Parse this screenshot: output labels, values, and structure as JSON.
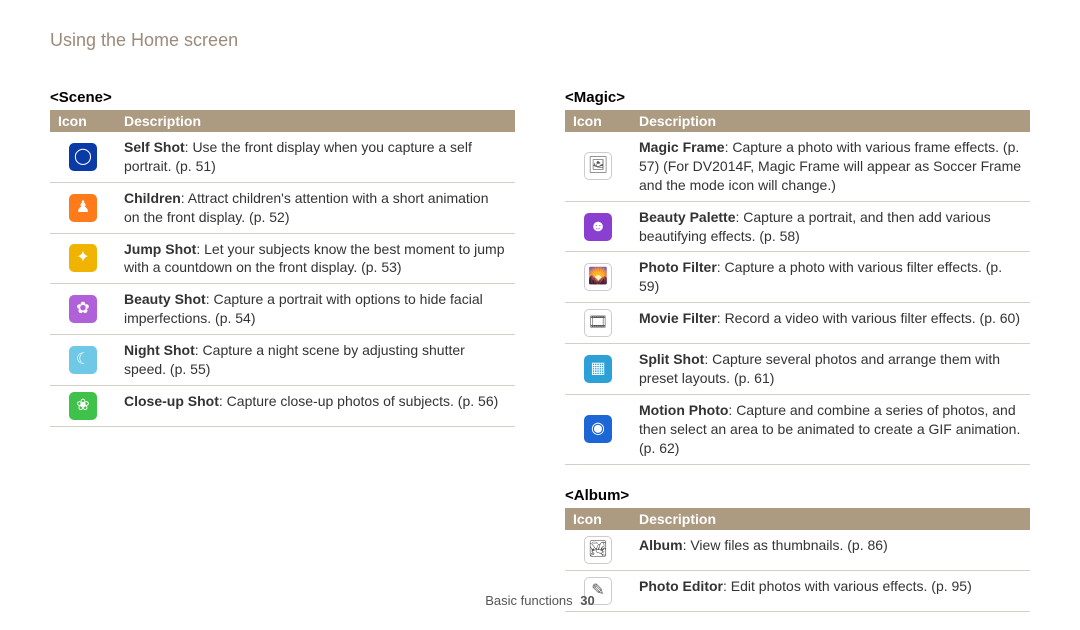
{
  "page_heading": "Using the Home screen",
  "table_headers": {
    "icon": "Icon",
    "description": "Description"
  },
  "sections": {
    "scene": {
      "title": "<Scene>",
      "rows": [
        {
          "icon": {
            "name": "self-shot-icon",
            "glyph": "◯",
            "bg": "#0a3aa6"
          },
          "bold": "Self Shot",
          "rest": ": Use the front display when you capture a self portrait. (p. 51)"
        },
        {
          "icon": {
            "name": "children-icon",
            "glyph": "♟",
            "bg": "#ff7a1a"
          },
          "bold": "Children",
          "rest": ": Attract children's attention with a short animation on the front display. (p. 52)"
        },
        {
          "icon": {
            "name": "jump-shot-icon",
            "glyph": "✦",
            "bg": "#f0b400"
          },
          "bold": "Jump Shot",
          "rest": ": Let your subjects know the best moment to jump with a countdown on the front display. (p. 53)"
        },
        {
          "icon": {
            "name": "beauty-shot-icon",
            "glyph": "✿",
            "bg": "#b060d8"
          },
          "bold": "Beauty Shot",
          "rest": ": Capture a portrait with options to hide facial imperfections. (p. 54)"
        },
        {
          "icon": {
            "name": "night-shot-icon",
            "glyph": "☾",
            "bg": "#6fc8e6"
          },
          "bold": "Night Shot",
          "rest": ": Capture a night scene by adjusting shutter speed. (p. 55)"
        },
        {
          "icon": {
            "name": "close-up-shot-icon",
            "glyph": "❀",
            "bg": "#3fc24a"
          },
          "bold": "Close-up Shot",
          "rest": ": Capture close-up photos of subjects. (p. 56)"
        }
      ]
    },
    "magic": {
      "title": "<Magic>",
      "rows": [
        {
          "icon": {
            "name": "magic-frame-icon",
            "glyph": "🖼",
            "bg": "#ffffff"
          },
          "bold": "Magic Frame",
          "rest": ": Capture a photo with various frame effects. (p. 57) (For DV2014F, Magic Frame will appear as Soccer Frame and the mode icon will change.)"
        },
        {
          "icon": {
            "name": "beauty-palette-icon",
            "glyph": "☻",
            "bg": "#8a3fd0"
          },
          "bold": "Beauty Palette",
          "rest": ": Capture a portrait, and then add various beautifying effects. (p. 58)"
        },
        {
          "icon": {
            "name": "photo-filter-icon",
            "glyph": "🌄",
            "bg": "#ffffff"
          },
          "bold": "Photo Filter",
          "rest": ": Capture a photo with various filter effects. (p. 59)"
        },
        {
          "icon": {
            "name": "movie-filter-icon",
            "glyph": "🎞",
            "bg": "#ffffff"
          },
          "bold": "Movie Filter",
          "rest": ": Record a video with various filter effects. (p. 60)"
        },
        {
          "icon": {
            "name": "split-shot-icon",
            "glyph": "▦",
            "bg": "#2ea0d8"
          },
          "bold": "Split Shot",
          "rest": ": Capture several photos and arrange them with preset layouts. (p. 61)"
        },
        {
          "icon": {
            "name": "motion-photo-icon",
            "glyph": "◉",
            "bg": "#1d66d6"
          },
          "bold": "Motion Photo",
          "rest": ": Capture and combine a series of photos, and then select an area to be animated to create a GIF animation. (p. 62)"
        }
      ]
    },
    "album": {
      "title": "<Album>",
      "rows": [
        {
          "icon": {
            "name": "album-icon",
            "glyph": "🏞",
            "bg": "#ffffff"
          },
          "bold": "Album",
          "rest": ": View files as thumbnails. (p. 86)"
        },
        {
          "icon": {
            "name": "photo-editor-icon",
            "glyph": "✎",
            "bg": "#ffffff"
          },
          "bold": "Photo Editor",
          "rest": ": Edit photos with various effects. (p. 95)"
        }
      ]
    }
  },
  "footer": {
    "section": "Basic functions",
    "page": "30"
  }
}
